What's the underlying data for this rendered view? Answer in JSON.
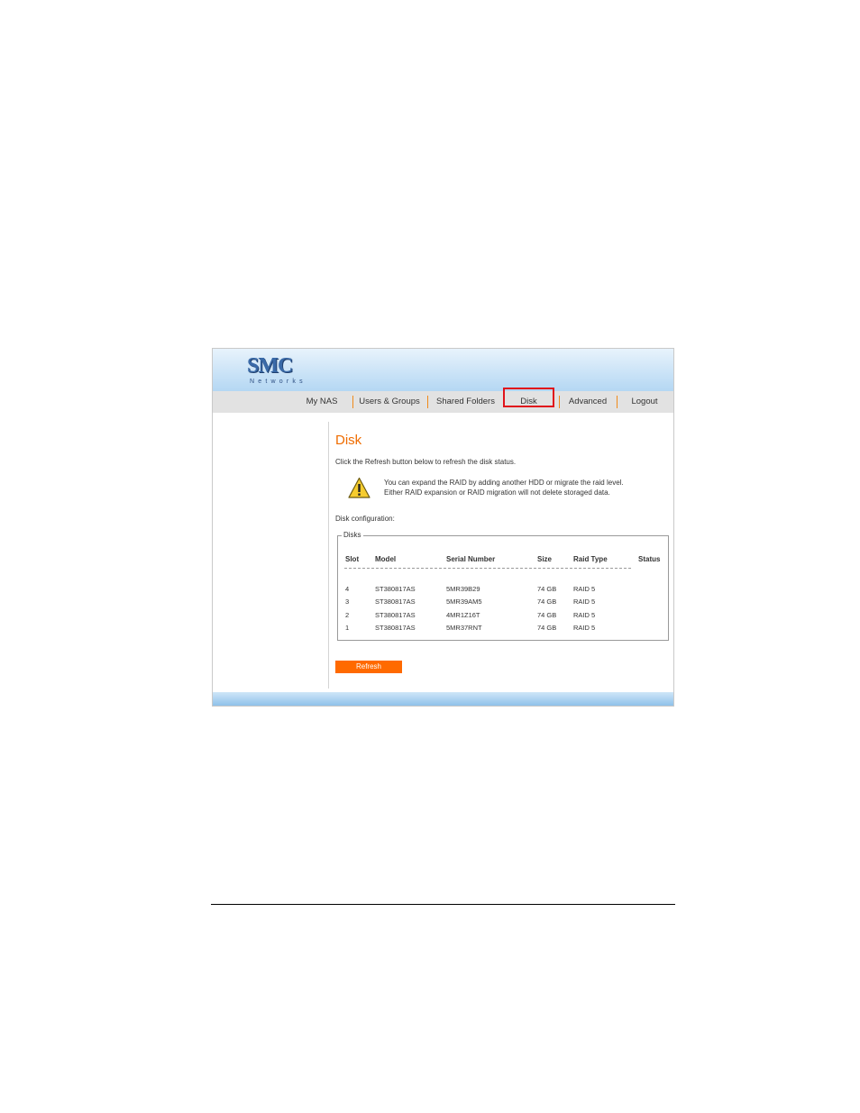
{
  "logo": {
    "main": "SMC",
    "sub": "Networks"
  },
  "nav": {
    "items": [
      {
        "label": "My NAS"
      },
      {
        "label": "Users & Groups"
      },
      {
        "label": "Shared Folders"
      },
      {
        "label": "Disk"
      },
      {
        "label": "Advanced"
      },
      {
        "label": "Logout"
      }
    ],
    "active": "Disk",
    "highlight_color": "#e0141c",
    "separator_color": "#f08a1a"
  },
  "page": {
    "title": "Disk",
    "intro": "Click the Refresh button below to refresh the disk status.",
    "warning_icon": "warning-triangle-icon",
    "warning_line1": "You can expand the RAID by adding another HDD or migrate the raid level.",
    "warning_line2": "Either RAID expansion or RAID migration will not delete storaged data.",
    "config_label": "Disk configuration:"
  },
  "disks": {
    "legend": "Disks",
    "headers": [
      "Slot",
      "Model",
      "Serial Number",
      "Size",
      "Raid Type",
      "Status"
    ],
    "rows": [
      [
        "4",
        "ST380817AS",
        "5MR39B29",
        "74 GB",
        "RAID 5",
        ""
      ],
      [
        "3",
        "ST380817AS",
        "5MR39AM5",
        "74 GB",
        "RAID 5",
        ""
      ],
      [
        "2",
        "ST380817AS",
        "4MR1Z16T",
        "74 GB",
        "RAID 5",
        ""
      ],
      [
        "1",
        "ST380817AS",
        "5MR37RNT",
        "74 GB",
        "RAID 5",
        ""
      ]
    ]
  },
  "actions": {
    "refresh_label": "Refresh"
  },
  "colors": {
    "accent": "#ef6c00",
    "button": "#ff6a00",
    "header_blue": "#b4d7f3"
  }
}
